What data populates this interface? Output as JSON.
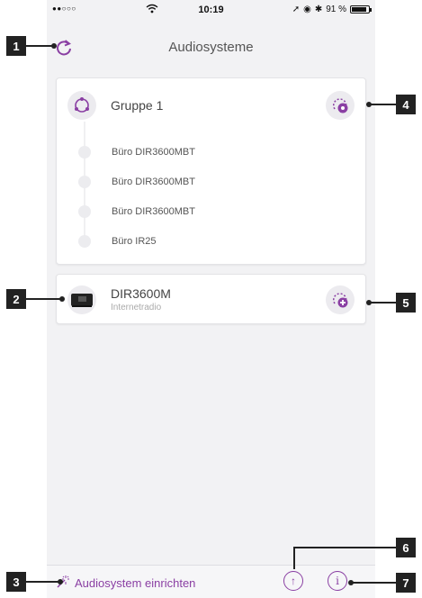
{
  "status_bar": {
    "signal": "●●○○○",
    "time": "10:19",
    "battery_text": "91 %",
    "battery_level": 0.91
  },
  "nav": {
    "title": "Audiosysteme",
    "refresh_icon": "refresh-icon"
  },
  "group": {
    "title": "Gruppe 1",
    "members": [
      "Büro DIR3600MBT",
      "Büro DIR3600MBT",
      "Büro DIR3600MBT",
      "Büro IR25"
    ]
  },
  "device": {
    "name": "DIR3600M",
    "subtitle": "Internetradio"
  },
  "toolbar": {
    "setup_label": "Audiosystem einrichten"
  },
  "callouts": [
    "1",
    "2",
    "3",
    "4",
    "5",
    "6",
    "7"
  ],
  "colors": {
    "accent": "#8a3fa3",
    "background": "#f2f2f4"
  }
}
